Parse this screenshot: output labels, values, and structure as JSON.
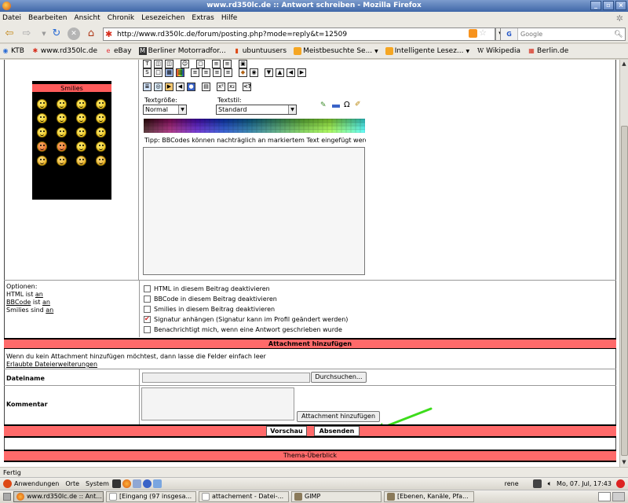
{
  "window": {
    "title": "www.rd350lc.de :: Antwort schreiben - Mozilla Firefox",
    "min": "_",
    "max": "▫",
    "close": "×"
  },
  "menu": [
    "Datei",
    "Bearbeiten",
    "Ansicht",
    "Chronik",
    "Lesezeichen",
    "Extras",
    "Hilfe"
  ],
  "nav": {
    "back": "⇦",
    "forward": "⇨",
    "reload": "↻",
    "stop": "✕",
    "home": "⌂",
    "url": "http://www.rd350lc.de/forum/posting.php?mode=reply&t=12509",
    "search_engine": "G",
    "search_placeholder": "Google"
  },
  "bookmarks": [
    "KTB",
    "www.rd350lc.de",
    "eBay",
    "Berliner Motorradfor...",
    "ubuntuusers",
    "Meistbesuchte Se...",
    "Intelligente Lesez...",
    "Wikipedia",
    "Berlin.de"
  ],
  "smilies": {
    "header": "Smilies"
  },
  "format": {
    "size_label": "Textgröße:",
    "size_value": "Normal",
    "style_label": "Textstil:",
    "style_value": "Standard",
    "omega": "Ω",
    "tip": "Tipp: BBCodes können nachträglich an markiertem Text eingefügt werd"
  },
  "toolbar_row1": [
    "T",
    "◫",
    "◫",
    "☺",
    "▢",
    "≡",
    "≡",
    "▣"
  ],
  "toolbar_row2": [
    "S",
    "□",
    "▦",
    "▥",
    "≡",
    "≡",
    "≡",
    "≡",
    "◆",
    "◉",
    "▼",
    "▲",
    "◀",
    "▶"
  ],
  "toolbar_row3": [
    "≣",
    "◎",
    "▶",
    "◀",
    "●",
    "▤",
    "x²",
    "x₂",
    "<?"
  ],
  "options": {
    "title": "Optionen:",
    "html_prefix": "HTML ist ",
    "html_state": "an",
    "bbcode_link": "BBCode",
    "bbcode_mid": " ist ",
    "bbcode_state": "an",
    "smilies_prefix": "Smilies sind ",
    "smilies_state": "an",
    "checks": [
      {
        "label": "HTML in diesem Beitrag deaktivieren",
        "checked": false
      },
      {
        "label": "BBCode in diesem Beitrag deaktivieren",
        "checked": false
      },
      {
        "label": "Smilies in diesem Beitrag deaktivieren",
        "checked": false
      },
      {
        "label": "Signatur anhängen (Signatur kann im Profil geändert werden)",
        "checked": true
      },
      {
        "label": "Benachrichtigt mich, wenn eine Antwort geschrieben wurde",
        "checked": false
      }
    ]
  },
  "attachment": {
    "header": "Attachment hinzufügen",
    "info": "Wenn du kein Attachment hinzufügen möchtest, dann lasse die Felder einfach leer",
    "extensions_link": "Erlaubte Dateierweiterungen",
    "filename_label": "Dateiname",
    "browse": "Durchsuchen...",
    "comment_label": "Kommentar",
    "add_button": "Attachment hinzufügen"
  },
  "submit": {
    "preview": "Vorschau",
    "send": "Absenden"
  },
  "topic_review": "Thema-Überblick",
  "status": "Fertig",
  "panel": {
    "apps": "Anwendungen",
    "places": "Orte",
    "system": "System",
    "user": "rene",
    "clock": "Mo, 07. Jul, 17:43"
  },
  "tasks": [
    "www.rd350lc.de :: Ant...",
    "[Eingang (97 insgesa...",
    "attachement - Datei-...",
    "GIMP",
    "[Ebenen, Kanäle, Pfa..."
  ],
  "colors": {
    "accent_red": "#ff6a6a",
    "annotation_arrow": "#3ddc1b",
    "title_blue": "#3f67a8"
  }
}
